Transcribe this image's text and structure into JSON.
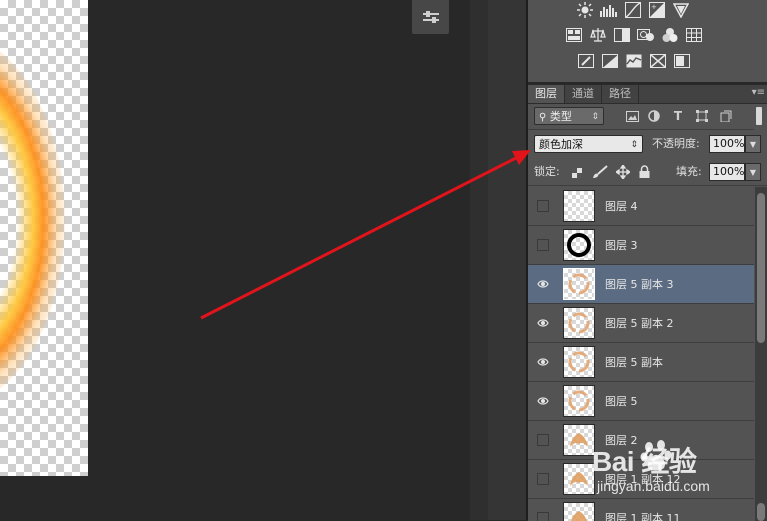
{
  "colors": {
    "accent_arrow": "#e0141a",
    "selected_row": "#5b6b82",
    "panel_bg": "#535353"
  },
  "tabs": [
    "图层",
    "通道",
    "路径"
  ],
  "filter": {
    "kind_label": "类型"
  },
  "blend": {
    "mode": "颜色加深",
    "opacity_label": "不透明度:",
    "opacity_value": "100%"
  },
  "lock": {
    "label": "锁定:",
    "fill_label": "填充:",
    "fill_value": "100%"
  },
  "layers": [
    {
      "name": "图层 4",
      "visible": false,
      "selected": false,
      "thumb": "empty"
    },
    {
      "name": "图层 3",
      "visible": false,
      "selected": false,
      "thumb": "ring"
    },
    {
      "name": "图层 5 副本 3",
      "visible": true,
      "selected": true,
      "thumb": "swirl"
    },
    {
      "name": "图层 5 副本 2",
      "visible": true,
      "selected": false,
      "thumb": "swirl"
    },
    {
      "name": "图层 5 副本",
      "visible": true,
      "selected": false,
      "thumb": "swirl"
    },
    {
      "name": "图层 5",
      "visible": true,
      "selected": false,
      "thumb": "swirl"
    },
    {
      "name": "图层 2",
      "visible": false,
      "selected": false,
      "thumb": "flame"
    },
    {
      "name": "图层 1 副本 12",
      "visible": false,
      "selected": false,
      "thumb": "flame"
    },
    {
      "name": "图层 1 副本 11",
      "visible": false,
      "selected": false,
      "thumb": "flame"
    }
  ],
  "watermark": {
    "brand": "Bai 经验",
    "url": "jingyan.baidu.com"
  }
}
